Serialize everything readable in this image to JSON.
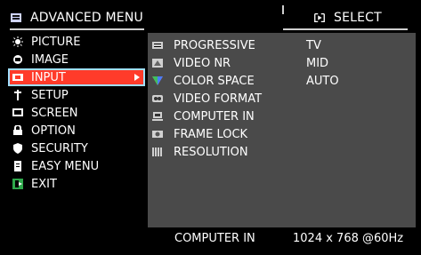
{
  "header": {
    "title": "ADVANCED MENU",
    "select_label": "SELECT",
    "select_icon": "enter-select-icon"
  },
  "left_menu": {
    "items": [
      {
        "label": "PICTURE",
        "icon": "picture-icon"
      },
      {
        "label": "IMAGE",
        "icon": "image-icon"
      },
      {
        "label": "INPUT",
        "icon": "input-icon",
        "selected": true
      },
      {
        "label": "SETUP",
        "icon": "setup-icon"
      },
      {
        "label": "SCREEN",
        "icon": "screen-icon"
      },
      {
        "label": "OPTION",
        "icon": "option-icon"
      },
      {
        "label": "SECURITY",
        "icon": "security-icon"
      },
      {
        "label": "EASY MENU",
        "icon": "easy-menu-icon"
      },
      {
        "label": "EXIT",
        "icon": "exit-icon"
      }
    ]
  },
  "input_panel": {
    "rows": [
      {
        "label": "PROGRESSIVE",
        "value": "TV",
        "icon": "progressive-icon"
      },
      {
        "label": "VIDEO NR",
        "value": "MID",
        "icon": "video-nr-icon"
      },
      {
        "label": "COLOR SPACE",
        "value": "AUTO",
        "icon": "color-space-icon"
      },
      {
        "label": "VIDEO FORMAT",
        "value": "",
        "icon": "video-format-icon"
      },
      {
        "label": "COMPUTER IN",
        "value": "",
        "icon": "computer-in-icon"
      },
      {
        "label": "FRAME LOCK",
        "value": "",
        "icon": "frame-lock-icon"
      },
      {
        "label": "RESOLUTION",
        "value": "",
        "icon": "resolution-icon"
      }
    ]
  },
  "footer": {
    "left": "COMPUTER IN",
    "right": "1024 x 768 @60Hz"
  },
  "colors": {
    "background": "#000000",
    "panel": "#4a4a4a",
    "selected": "#ff3b2a",
    "selected_border": "#a0dfff",
    "text": "#ffffff"
  }
}
